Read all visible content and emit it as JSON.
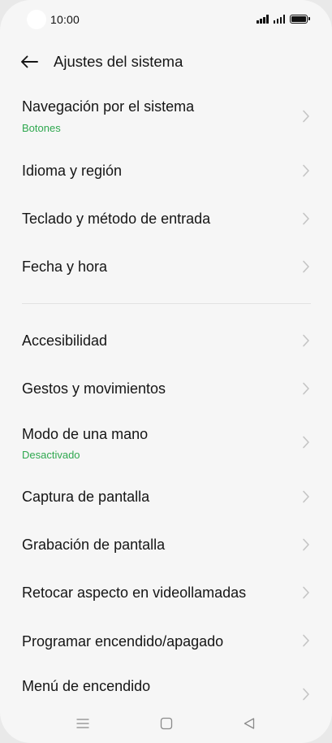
{
  "status_bar": {
    "time": "10:00"
  },
  "header": {
    "title": "Ajustes del sistema",
    "back_icon": "arrow-left-icon"
  },
  "items": [
    {
      "label": "Navegación por el sistema",
      "sub": "Botones"
    },
    {
      "label": "Idioma y región"
    },
    {
      "label": "Teclado y método de entrada"
    },
    {
      "label": "Fecha y hora"
    },
    {
      "label": "Accesibilidad"
    },
    {
      "label": "Gestos y movimientos"
    },
    {
      "label": "Modo de una mano",
      "sub": "Desactivado"
    },
    {
      "label": "Captura de pantalla"
    },
    {
      "label": "Grabación de pantalla"
    },
    {
      "label": "Retocar aspecto en videollamadas"
    },
    {
      "label": "Programar encendido/apagado"
    },
    {
      "label": "Menú de encendido"
    }
  ],
  "nav_bar": {
    "icons": [
      "menu-icon",
      "home-square-icon",
      "back-triangle-icon"
    ]
  },
  "colors": {
    "background": "#f6f6f6",
    "text": "#151515",
    "subtitle_accent": "#2fa84f",
    "chevron": "#c4c4c4"
  }
}
